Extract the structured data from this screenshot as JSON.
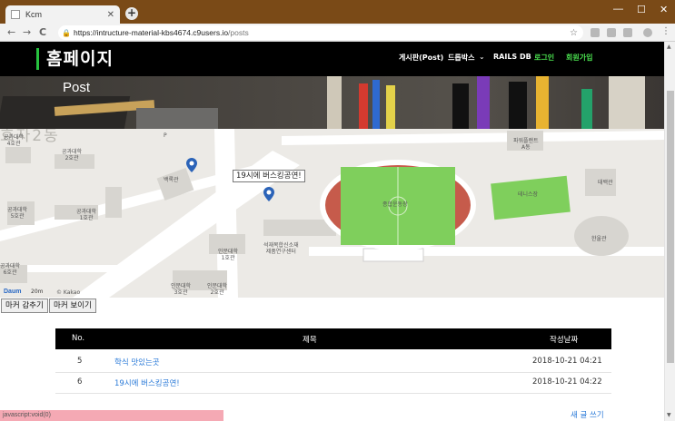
{
  "browser": {
    "tab_title": "Kcm",
    "tab_close": "✕",
    "new_tab": "+",
    "url_host": "https://intructure-material-kbs4674.c9users.io",
    "url_path": "/posts",
    "win_min": "—",
    "win_max": "☐",
    "win_close": "✕",
    "back": "←",
    "forward": "→",
    "reload": "C",
    "status_text": "javascript:void(0)"
  },
  "header": {
    "brand": "홈페이지",
    "nav": [
      "게시판(Post)",
      "드롭박스",
      "RAILS DB",
      "로그인",
      "회원가입"
    ]
  },
  "hero": {
    "title": "Post"
  },
  "map": {
    "labels": {
      "district": "효자2동",
      "eng4": "공과대학\n4호관",
      "eng2": "공과대학\n2호관",
      "eng5": "공과대학\n5호관",
      "eng1": "공과대학\n1호관",
      "eng6": "공과대학\n6호관",
      "baekrok": "백록관",
      "hum1": "인문대학\n1호관",
      "hum3": "인문대학\n3호관",
      "hum2": "인문대학\n2호관",
      "stone": "석재복합신소재\n제품연구센터",
      "stadium": "종합운동장",
      "tennis": "테니스장",
      "taebaek": "태백관",
      "hanul": "한울관",
      "power": "파워플랜트\nA동",
      "p": "P"
    },
    "info_window": "19시에 버스킹공연!",
    "logo": "Daum",
    "scale": "20m",
    "copyright": "© Kakao"
  },
  "buttons": {
    "hide_markers": "마커 감추기",
    "show_markers": "마커 보이기"
  },
  "table": {
    "columns": [
      "No.",
      "제목",
      "작성날짜"
    ],
    "rows": [
      {
        "no": "5",
        "title": "학식 맛있는곳",
        "date": "2018-10-21 04:21"
      },
      {
        "no": "6",
        "title": "19시에 버스킹공연!",
        "date": "2018-10-21 04:22"
      }
    ]
  },
  "write_link": "새 글 쓰기",
  "colors": {
    "accent_green": "#27c23f",
    "link_blue": "#2a7ad8",
    "header_bg": "#000000"
  }
}
